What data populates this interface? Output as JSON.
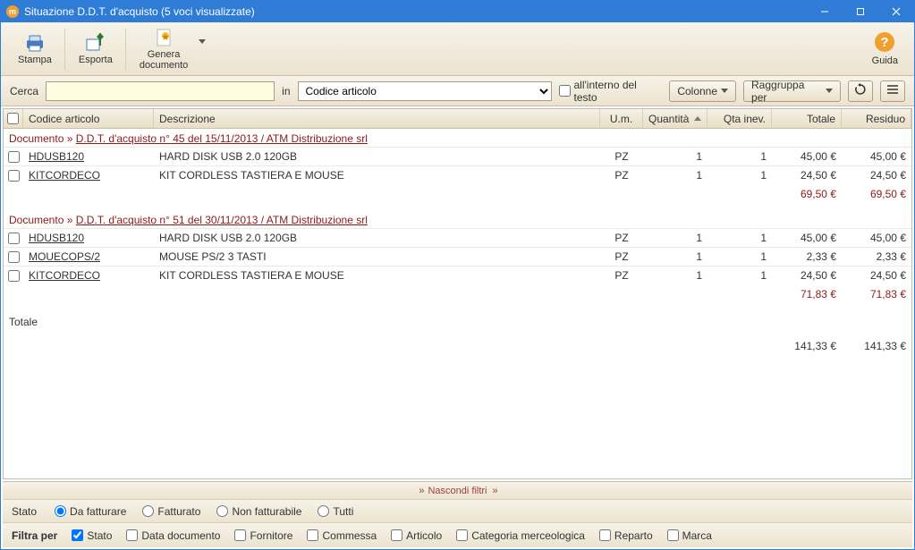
{
  "window": {
    "title": "Situazione D.D.T. d'acquisto (5 voci visualizzate)"
  },
  "toolbar": {
    "print": "Stampa",
    "export": "Esporta",
    "generate_doc": "Genera\ndocumento",
    "help": "Guida"
  },
  "search": {
    "label": "Cerca",
    "value": "",
    "in_label": "in",
    "combo_value": "Codice articolo",
    "inside_text": "all'interno del testo",
    "columns_btn": "Colonne",
    "group_by_btn": "Raggruppa per"
  },
  "grid": {
    "headers": {
      "code": "Codice articolo",
      "desc": "Descrizione",
      "um": "U.m.",
      "qty": "Quantità",
      "qty_inev": "Qta inev.",
      "total": "Totale",
      "residuo": "Residuo"
    },
    "groups": [
      {
        "prefix": "Documento",
        "link": "D.D.T. d'acquisto n° 45 del 15/11/2013 / ATM Distribuzione srl",
        "rows": [
          {
            "code": "HDUSB120",
            "desc": "HARD DISK USB 2.0 120GB",
            "um": "PZ",
            "qty": "1",
            "qin": "1",
            "tot": "45,00 €",
            "res": "45,00 €"
          },
          {
            "code": "KITCORDECO",
            "desc": "KIT CORDLESS TASTIERA E MOUSE",
            "um": "PZ",
            "qty": "1",
            "qin": "1",
            "tot": "24,50 €",
            "res": "24,50 €"
          }
        ],
        "subtotal": {
          "tot": "69,50 €",
          "res": "69,50 €"
        }
      },
      {
        "prefix": "Documento",
        "link": "D.D.T. d'acquisto n° 51 del 30/11/2013 / ATM Distribuzione srl",
        "rows": [
          {
            "code": "HDUSB120",
            "desc": "HARD DISK USB 2.0 120GB",
            "um": "PZ",
            "qty": "1",
            "qin": "1",
            "tot": "45,00 €",
            "res": "45,00 €"
          },
          {
            "code": "MOUECOPS/2",
            "desc": "MOUSE PS/2 3 TASTI",
            "um": "PZ",
            "qty": "1",
            "qin": "1",
            "tot": "2,33 €",
            "res": "2,33 €"
          },
          {
            "code": "KITCORDECO",
            "desc": "KIT CORDLESS TASTIERA E MOUSE",
            "um": "PZ",
            "qty": "1",
            "qin": "1",
            "tot": "24,50 €",
            "res": "24,50 €"
          }
        ],
        "subtotal": {
          "tot": "71,83 €",
          "res": "71,83 €"
        }
      }
    ],
    "total_label": "Totale",
    "grand_total": {
      "tot": "141,33 €",
      "res": "141,33 €"
    }
  },
  "hide_filters": "Nascondi filtri",
  "filters1": {
    "label": "Stato",
    "options": {
      "da_fatturare": "Da fatturare",
      "fatturato": "Fatturato",
      "non_fatturabile": "Non fatturabile",
      "tutti": "Tutti"
    },
    "selected": "da_fatturare"
  },
  "filters2": {
    "label": "Filtra per",
    "items": {
      "stato": "Stato",
      "data_doc": "Data documento",
      "fornitore": "Fornitore",
      "commessa": "Commessa",
      "articolo": "Articolo",
      "cat_merc": "Categoria merceologica",
      "reparto": "Reparto",
      "marca": "Marca"
    },
    "checked": [
      "stato"
    ]
  }
}
